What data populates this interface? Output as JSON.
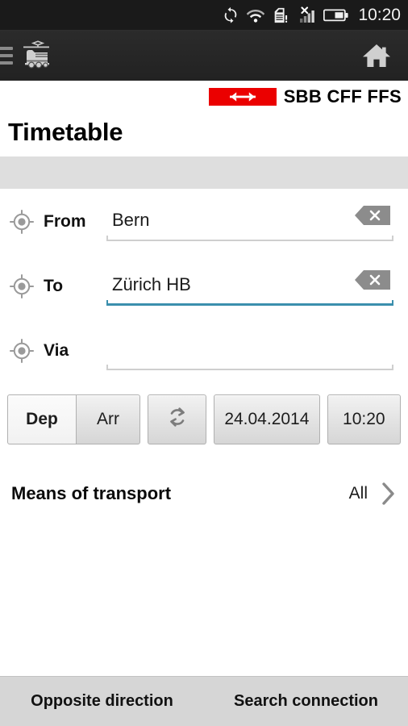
{
  "statusbar": {
    "time": "10:20",
    "icons": [
      "sync-icon",
      "wifi-icon",
      "sim-card-alert-icon",
      "signal-no-service-icon",
      "battery-icon"
    ]
  },
  "actionbar": {
    "menu_icon": "hamburger-menu-icon",
    "app_icon": "train-icon",
    "home_icon": "home-icon"
  },
  "brand": {
    "mark_label": "SBB logo",
    "wordmark": "SBB CFF FFS",
    "red": "#EB0000"
  },
  "page": {
    "title": "Timetable"
  },
  "form": {
    "fields": [
      {
        "label": "From",
        "value": "Bern",
        "placeholder": "",
        "focused": false,
        "has_clear": true,
        "loc_icon": "gps-target-icon"
      },
      {
        "label": "To",
        "value": "Zürich HB",
        "placeholder": "",
        "focused": true,
        "has_clear": true,
        "loc_icon": "gps-target-icon"
      },
      {
        "label": "Via",
        "value": "",
        "placeholder": "",
        "focused": false,
        "has_clear": false,
        "loc_icon": "gps-target-icon"
      }
    ]
  },
  "options": {
    "dep_label": "Dep",
    "arr_label": "Arr",
    "selected_mode": "Dep",
    "swap_icon": "swap-refresh-icon",
    "date": "24.04.2014",
    "time": "10:20"
  },
  "means_of_transport": {
    "label": "Means of transport",
    "value": "All",
    "chevron_icon": "chevron-right-icon"
  },
  "bottombar": {
    "opposite_label": "Opposite direction",
    "search_label": "Search connection"
  },
  "colors": {
    "accent_focus": "#3B8FAD",
    "brand_red": "#EB0000",
    "statusbar_bg": "#1A1A1A",
    "actionbar_bg": "#262626",
    "graybar_bg": "#DEDEDE",
    "bottombar_bg": "#D6D6D6"
  }
}
